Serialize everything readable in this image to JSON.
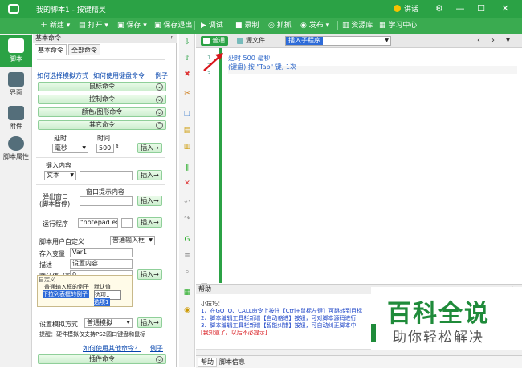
{
  "window": {
    "title": "我的脚本1 - 按键精灵",
    "user": "讲话",
    "controls": [
      "⚙",
      "—",
      "☐",
      "✕"
    ]
  },
  "toolbar": {
    "items": [
      "新建",
      "打开",
      "保存",
      "保存退出",
      "调试",
      "录制",
      "抓抓",
      "发布",
      "资源库",
      "学习中心"
    ]
  },
  "leftnav": {
    "items": [
      "脚本",
      "界面",
      "附件",
      "脚本属性"
    ]
  },
  "panel": {
    "header": "基本命令",
    "pin": "ᵖ",
    "tabs": [
      "基本命令",
      "全部命令"
    ],
    "links": [
      "如何选择模拟方式",
      "如何使用键盘命令",
      "例子"
    ],
    "groups": [
      "鼠标命令",
      "控制命令",
      "颜色/图形命令",
      "其它命令"
    ],
    "delay": {
      "label_delay": "延时",
      "label_time": "时间",
      "unit": "毫秒",
      "value": "500",
      "insert": "插入→"
    },
    "keyinput": {
      "label": "键入内容",
      "type": "文本",
      "value": "",
      "insert": "插入→"
    },
    "popup_window": {
      "label1": "弹出窗口",
      "label2": "(脚本暂停)",
      "hint": "窗口提示内容",
      "value": "",
      "insert": "插入→"
    },
    "run": {
      "label": "运行程序",
      "value": "\"notepad.exe\"",
      "browse": "...",
      "insert": "插入→"
    },
    "userdef": {
      "label": "脚本用户自定义",
      "mode": "普通输入框",
      "var_label": "存入变量",
      "var_value": "Var1",
      "desc_label": "描述",
      "desc_value": "设置内容",
      "default_label": "默认值（可选）",
      "default_value": "0",
      "insert": "插入→"
    },
    "popup_list": {
      "header": "自定义",
      "row1_a": "普通输入框的例子",
      "row1_b": "默认值",
      "row2_a": "下拉列表框的例子",
      "row2_b": "选项1",
      "row3_b": "选项1"
    },
    "sim": {
      "label": "设置模拟方式",
      "mode": "普通模拟",
      "insert": "插入→",
      "tip": "提醒：硬件模拟仅支持PS2圆口键盘和鼠标"
    },
    "bottom_links": [
      "如何使用其他命令？",
      "例子"
    ],
    "plugin": "插件命令"
  },
  "editor": {
    "mode_normal": "普通",
    "mode_source": "源文件",
    "combo_value": "插入子程序",
    "nav_prev": "‹",
    "nav_next": "›",
    "nav_down": "▾",
    "lines": [
      "1",
      "2",
      "3"
    ],
    "code": [
      "延时 500 毫秒",
      "(键盘) 按 \"Tab\" 键, 1次"
    ]
  },
  "help": {
    "title": "帮助",
    "close": "✕",
    "tip_title": "小技巧：",
    "tips": [
      "1、在GOTO、CALL命令上按住【Ctrl+鼠标左键】可跳转到目标",
      "2、脚本编辑工具栏新增【自动缩进】按钮，可对脚本源码进行",
      "3、脚本编辑工具栏新增【智能纠错】按钮，可自动纠正脚本中"
    ],
    "tip_red": "[我知道了，以后不必提示]",
    "tabs": [
      "帮助",
      "脚本信息"
    ]
  },
  "watermark": {
    "line1": "百科全说",
    "line2": "助你轻松解决"
  },
  "colors": {
    "brand": "#2ba245",
    "link": "#0645ad",
    "tip": "#1c44c7",
    "red": "#d8161b"
  }
}
